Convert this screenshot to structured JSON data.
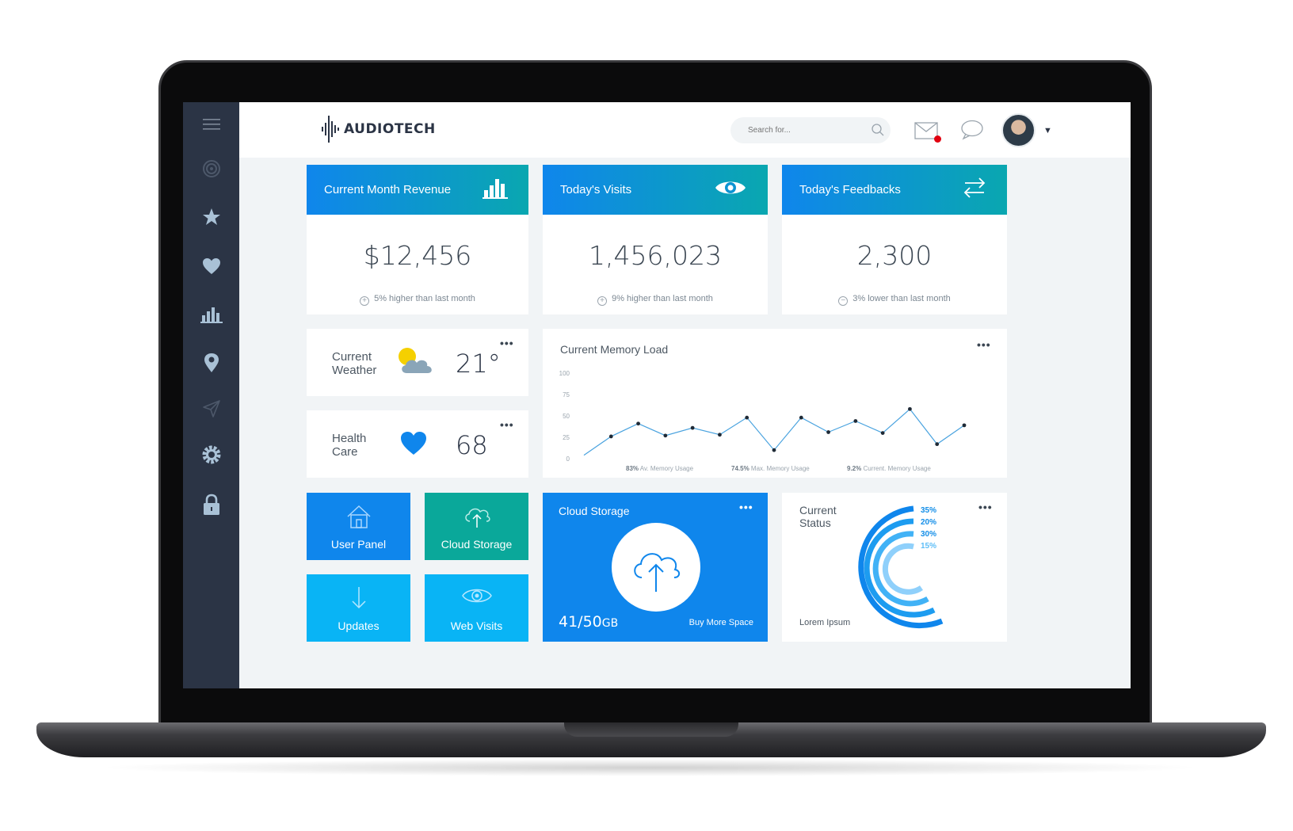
{
  "brand": {
    "name": "AUDIOTECH"
  },
  "search": {
    "placeholder": "Search for..."
  },
  "stats": [
    {
      "title": "Current Month Revenue",
      "value": "$12,456",
      "note": "5% higher than last month",
      "sign": "+"
    },
    {
      "title": "Today's Visits",
      "value": "1,456,023",
      "note": "9% higher than last month",
      "sign": "+"
    },
    {
      "title": "Today's Feedbacks",
      "value": "2,300",
      "note": "3% lower than last month",
      "sign": "−"
    }
  ],
  "weather": {
    "label": "Current Weather",
    "value": "21°"
  },
  "health": {
    "label": "Health Care",
    "value": "68"
  },
  "memory": {
    "title": "Current Memory Load",
    "footer": [
      {
        "value": "83%",
        "label": "Av. Memory Usage"
      },
      {
        "value": "74.5%",
        "label": "Max. Memory Usage"
      },
      {
        "value": "9.2%",
        "label": "Current. Memory Usage"
      }
    ]
  },
  "tiles": [
    {
      "label": "User Panel",
      "color": "#0f86ec"
    },
    {
      "label": "Cloud Storage",
      "color": "#0aa89a"
    },
    {
      "label": "Updates",
      "color": "#09b4f5"
    },
    {
      "label": "Web Visits",
      "color": "#09b4f5"
    }
  ],
  "storage": {
    "title": "Cloud Storage",
    "used": "41/50",
    "unit": "GB",
    "link": "Buy More Space"
  },
  "status": {
    "label": "Current Status",
    "caption": "Lorem Ipsum",
    "percents": [
      "35%",
      "20%",
      "30%",
      "15%"
    ]
  },
  "menu_dots": "•••",
  "colors": {
    "sidebar": "#2b3445",
    "accent": "#0f86ec",
    "teal": "#0aa7b0"
  },
  "chart_data": {
    "type": "line",
    "title": "Current Memory Load",
    "yticks": [
      0,
      25,
      50,
      75,
      100
    ],
    "ylim": [
      0,
      100
    ],
    "values": [
      4,
      26,
      41,
      27,
      36,
      28,
      48,
      10,
      48,
      31,
      44,
      30,
      58,
      17,
      39
    ],
    "grid": false,
    "color": "#4aa3df"
  }
}
